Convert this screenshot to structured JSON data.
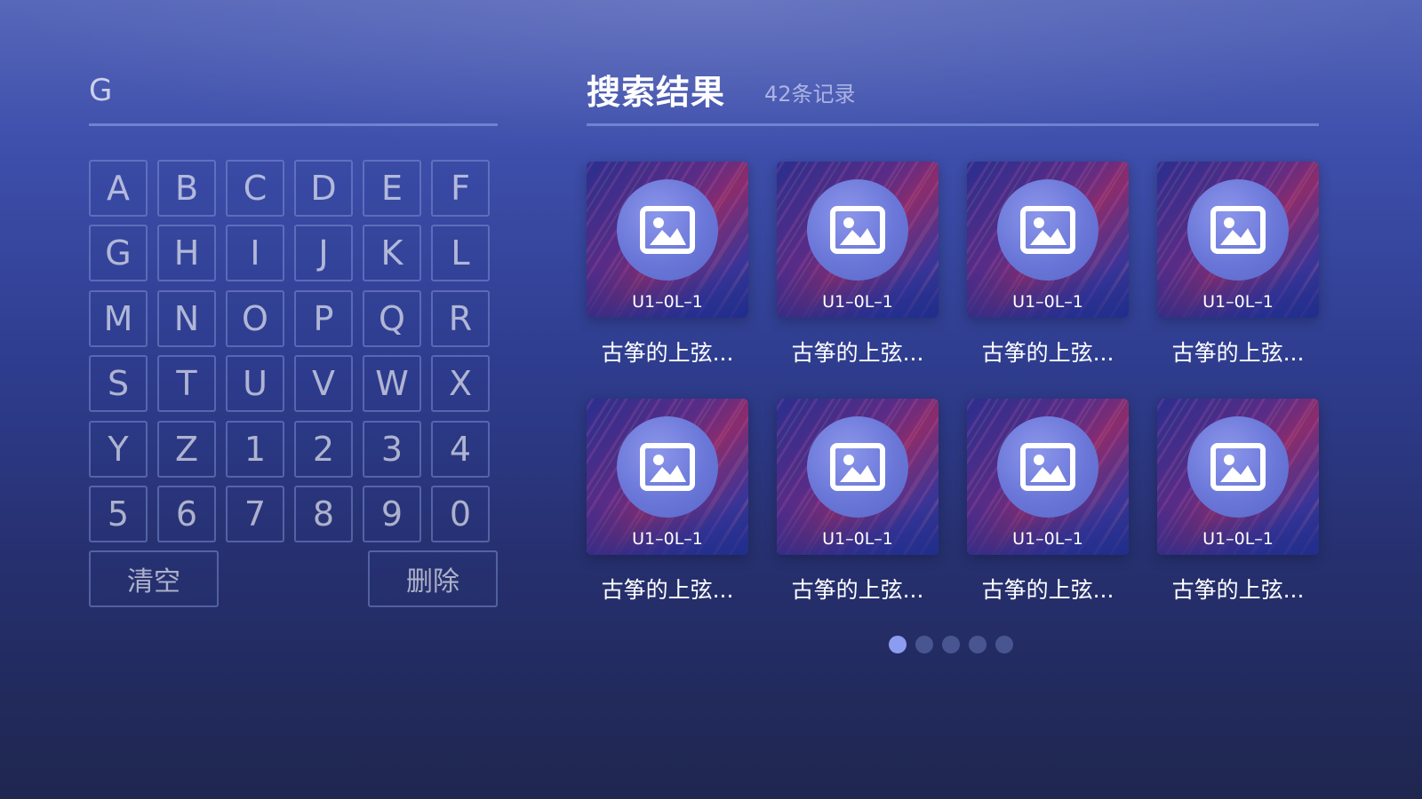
{
  "search": {
    "query": "G"
  },
  "keyboard": {
    "keys": [
      "A",
      "B",
      "C",
      "D",
      "E",
      "F",
      "G",
      "H",
      "I",
      "J",
      "K",
      "L",
      "M",
      "N",
      "O",
      "P",
      "Q",
      "R",
      "S",
      "T",
      "U",
      "V",
      "W",
      "X",
      "Y",
      "Z",
      "1",
      "2",
      "3",
      "4",
      "5",
      "6",
      "7",
      "8",
      "9",
      "0"
    ],
    "clear_label": "清空",
    "delete_label": "删除"
  },
  "results": {
    "title": "搜索结果",
    "count": "42条记录",
    "items": [
      {
        "thumb_label": "U1–0L–1",
        "title": "古筝的上弦..."
      },
      {
        "thumb_label": "U1–0L–1",
        "title": "古筝的上弦..."
      },
      {
        "thumb_label": "U1–0L–1",
        "title": "古筝的上弦..."
      },
      {
        "thumb_label": "U1–0L–1",
        "title": "古筝的上弦..."
      },
      {
        "thumb_label": "U1–0L–1",
        "title": "古筝的上弦..."
      },
      {
        "thumb_label": "U1–0L–1",
        "title": "古筝的上弦..."
      },
      {
        "thumb_label": "U1–0L–1",
        "title": "古筝的上弦..."
      },
      {
        "thumb_label": "U1–0L–1",
        "title": "古筝的上弦..."
      }
    ]
  },
  "pagination": {
    "total_pages": 5,
    "current_page": 1
  },
  "colors": {
    "accent": "#8c9cf0",
    "background_top": "#5767b9",
    "background_bottom": "#1f264f"
  },
  "icons": {
    "thumbnail": "image-icon"
  }
}
